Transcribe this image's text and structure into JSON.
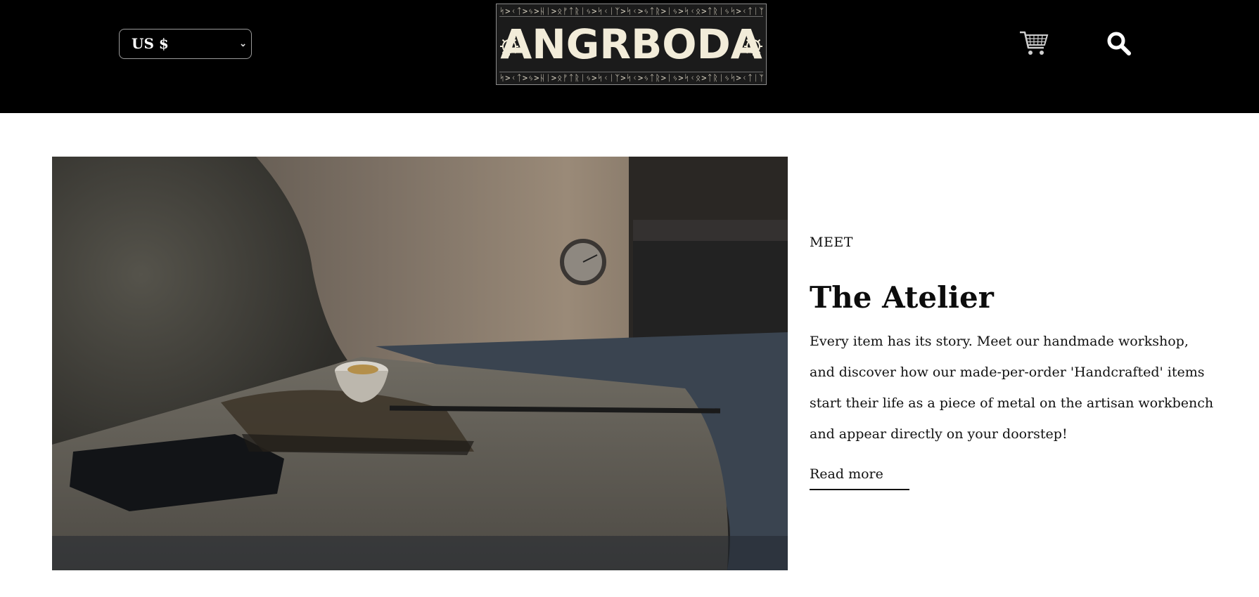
{
  "header": {
    "currency": {
      "selected": "US $"
    },
    "logo": {
      "wordmark": "ANGRBODA",
      "runes_top": "ᛋᛋᛋᛋᛋᛋᛋᛋᛋᛋᛋᛋᛋᛋᛋᛋᛋᛋᛋᛋᛋᛋᛋᛋᛋᛋᛋᛋᛋᛋᛋᛋᛋᛋᛋᛋᛋᛋᛋᛋᛋᛋᛋ",
      "runes_bottom": "ᛋᛋᛋᛋᛋᛋᛋᛋᛋᛋᛋᛋᛋᛋᛋᛋᛋᛋᛋᛋᛋᛋᛋᛋᛋᛋᛋᛋᛋᛋᛋᛋᛋᛋᛋᛋᛋᛋᛋᛋᛋᛋᛋ"
    },
    "icons": {
      "cart": "cart-icon",
      "search": "search-icon"
    }
  },
  "feature": {
    "eyebrow": "MEET",
    "title": "The Atelier",
    "body": "Every item has its story. Meet our handmade workshop, and discover how our made-per-order 'Handcrafted' items start their life as a piece of metal on the artisan workbench and appear directly on your doorstep!",
    "link_label": "Read more"
  },
  "colors": {
    "header_bg": "#000000",
    "page_bg": "#ffffff",
    "text": "#111111",
    "logo_cream": "#f2ecd9"
  }
}
